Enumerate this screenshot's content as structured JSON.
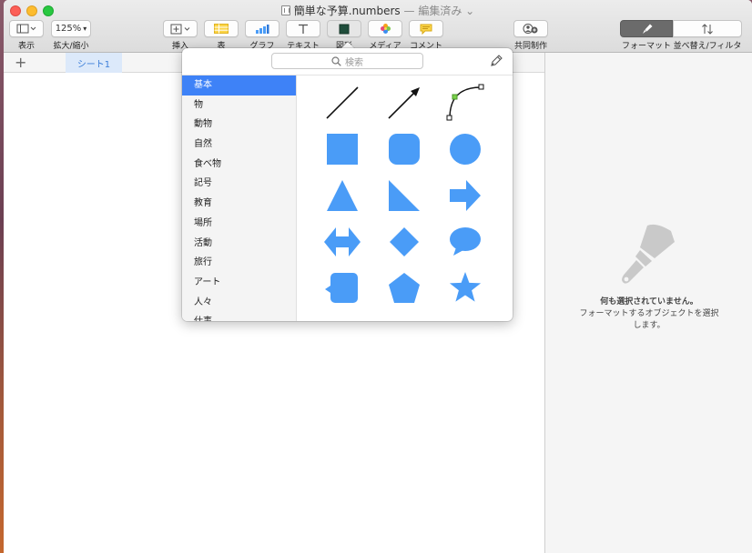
{
  "window": {
    "title": "簡単な予算.numbers",
    "status": "— 編集済み"
  },
  "toolbar": {
    "view_label": "表示",
    "zoom_value": "125%",
    "zoom_label": "拡大/縮小",
    "insert_label": "挿入",
    "table_label": "表",
    "chart_label": "グラフ",
    "text_label": "テキスト",
    "shape_label": "図形",
    "media_label": "メディア",
    "comment_label": "コメント",
    "collaborate_label": "共同制作",
    "format_label": "フォーマット",
    "sort_label": "並べ替え/フィルタ"
  },
  "sheets": {
    "add": "+",
    "tabs": [
      "シート1"
    ]
  },
  "popover": {
    "search_placeholder": "検索",
    "categories": [
      "基本",
      "物",
      "動物",
      "自然",
      "食べ物",
      "記号",
      "教育",
      "場所",
      "活動",
      "旅行",
      "アート",
      "人々",
      "仕事"
    ],
    "selected_category": "基本",
    "shapes": [
      "line",
      "arrow-line",
      "curve",
      "square",
      "rounded-square",
      "circle",
      "triangle",
      "right-triangle",
      "arrow",
      "double-arrow",
      "diamond",
      "speech-bubble",
      "callout-square",
      "pentagon",
      "star"
    ],
    "shape_color": "#4a9cf7"
  },
  "inspector": {
    "line1": "何も選択されていません。",
    "line2": "フォーマットするオブジェクトを選択",
    "line3": "します。"
  }
}
